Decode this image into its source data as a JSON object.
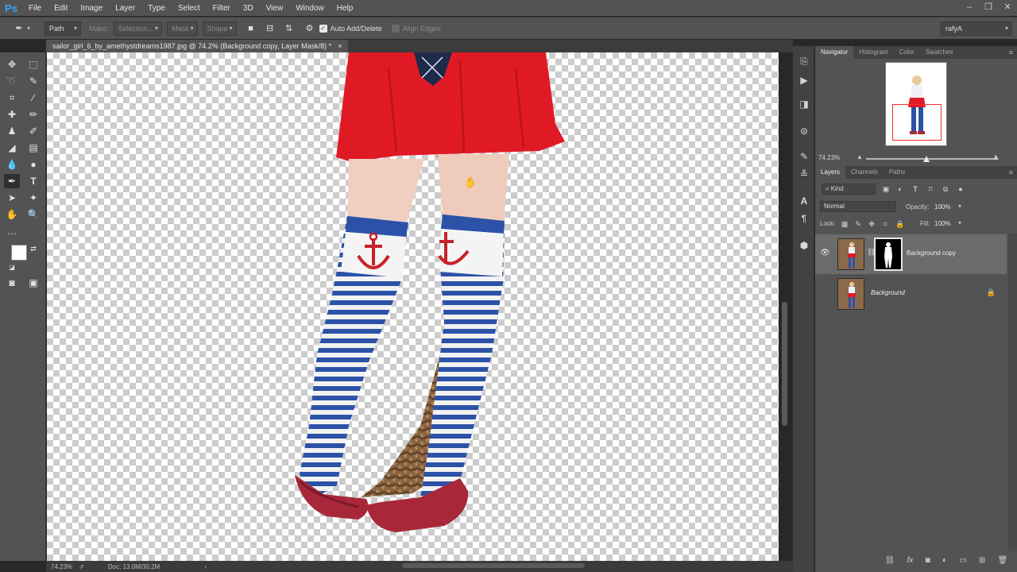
{
  "app": {
    "logo": "Ps",
    "menu": [
      "File",
      "Edit",
      "Image",
      "Layer",
      "Type",
      "Select",
      "Filter",
      "3D",
      "View",
      "Window",
      "Help"
    ]
  },
  "window_controls": {
    "minimize": "–",
    "restore": "❐",
    "close": "✕"
  },
  "options": {
    "tool_mode": "Path",
    "make_label": "Make:",
    "selection_label": "Selection...",
    "mask_label": "Mask",
    "shape_label": "Shape",
    "auto_add_delete": "Auto Add/Delete",
    "align_edges": "Align Edges",
    "workspace": "rafyA"
  },
  "document": {
    "tab_title": "sailor_girl_6_by_amethystdreams1987.jpg @ 74.2% (Background copy, Layer Mask/8) *",
    "close": "×"
  },
  "status": {
    "zoom": "74.23%",
    "doc": "Doc: 13.0M/30.2M",
    "arrow": "›"
  },
  "navigator": {
    "tabs": [
      "Navigator",
      "Histogram",
      "Color",
      "Swatches"
    ],
    "zoom": "74.23%"
  },
  "layers_panel": {
    "tabs": [
      "Layers",
      "Channels",
      "Paths"
    ],
    "filter": "Kind",
    "blend_mode": "Normal",
    "opacity_label": "Opacity:",
    "opacity": "100%",
    "lock_label": "Lock:",
    "fill_label": "Fill:",
    "fill": "100%",
    "layers": [
      {
        "name": "Background copy",
        "visible": true,
        "has_mask": true,
        "selected": true
      },
      {
        "name": "Background",
        "visible": false,
        "locked": true,
        "selected": false
      }
    ]
  },
  "colors": {
    "accent_blue": "#31a8ff",
    "skirt_red": "#e01a24",
    "sock_blue": "#2c52a8",
    "shoe_red": "#a8283a",
    "nav_view_box": "#ff2a2a"
  }
}
